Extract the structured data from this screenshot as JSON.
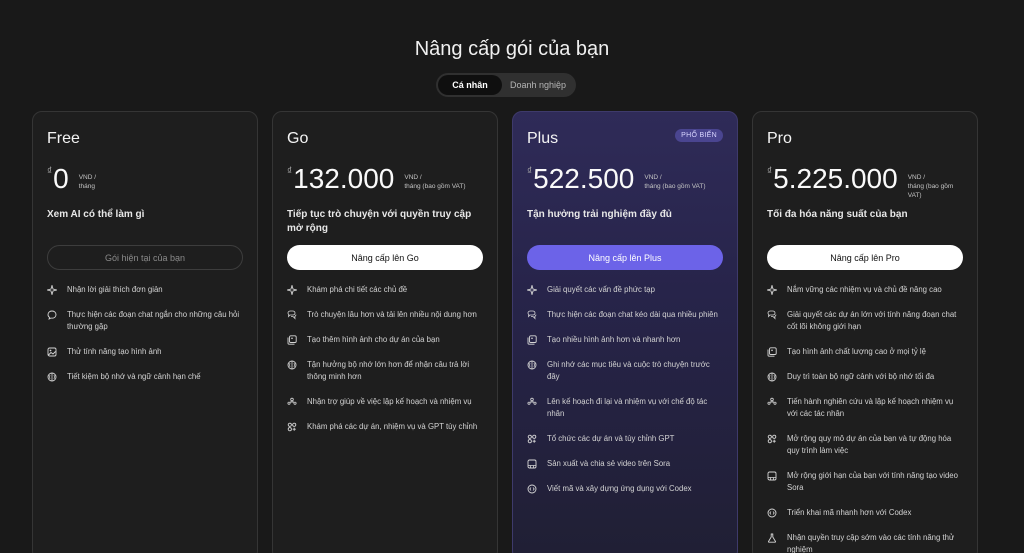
{
  "page_title": "Nâng cấp gói của bạn",
  "toggle": {
    "personal": "Cá nhân",
    "business": "Doanh nghiệp"
  },
  "plans": [
    {
      "name": "Free",
      "currency": "₫",
      "amount": "0",
      "price_line1": "VND /",
      "price_line2": "tháng",
      "tagline": "Xem AI có thể làm gì",
      "cta": "Gói hiện tại của bạn",
      "features": [
        {
          "icon": "sparkle-icon",
          "text": "Nhận lời giải thích đơn giản"
        },
        {
          "icon": "chat-bubble-icon",
          "text": "Thực hiện các đoạn chat ngắn cho những câu hỏi thường gặp"
        },
        {
          "icon": "image-icon",
          "text": "Thử tính năng tạo hình ảnh"
        },
        {
          "icon": "brain-icon",
          "text": "Tiết kiệm bộ nhớ và ngữ cảnh hạn chế"
        }
      ]
    },
    {
      "name": "Go",
      "currency": "₫",
      "amount": "132.000",
      "price_line1": "VND /",
      "price_line2": "tháng (bao gồm VAT)",
      "tagline": "Tiếp tục trò chuyện với quyền truy cập mở rộng",
      "cta": "Nâng cấp lên Go",
      "features": [
        {
          "icon": "sparkle-icon",
          "text": "Khám phá chi tiết các chủ đề"
        },
        {
          "icon": "chat-bubbles-icon",
          "text": "Trò chuyện lâu hơn và tải lên nhiều nội dung hơn"
        },
        {
          "icon": "images-icon",
          "text": "Tạo thêm hình ảnh cho dự án của bạn"
        },
        {
          "icon": "brain-icon",
          "text": "Tận hưởng bộ nhớ lớn hơn để nhận câu trả lời thông minh hơn"
        },
        {
          "icon": "team-icon",
          "text": "Nhận trợ giúp về việc lập kế hoạch và nhiệm vụ"
        },
        {
          "icon": "apps-icon",
          "text": "Khám phá các dự án, nhiệm vụ và GPT tùy chỉnh"
        }
      ]
    },
    {
      "name": "Plus",
      "badge": "PHỔ BIẾN",
      "currency": "₫",
      "amount": "522.500",
      "price_line1": "VND /",
      "price_line2": "tháng (bao gồm VAT)",
      "tagline": "Tận hưởng trải nghiệm đầy đủ",
      "cta": "Nâng cấp lên Plus",
      "features": [
        {
          "icon": "sparkle-icon",
          "text": "Giải quyết các vấn đề phức tạp"
        },
        {
          "icon": "chat-bubbles-icon",
          "text": "Thực hiện các đoạn chat kéo dài qua nhiều phiên"
        },
        {
          "icon": "images-icon",
          "text": "Tạo nhiều hình ảnh hơn và nhanh hơn"
        },
        {
          "icon": "brain-icon",
          "text": "Ghi nhớ các mục tiêu và cuộc trò chuyện trước đây"
        },
        {
          "icon": "team-icon",
          "text": "Lên kế hoạch đi lại và nhiệm vụ với chế độ tác nhân"
        },
        {
          "icon": "apps-icon",
          "text": "Tổ chức các dự án và tùy chỉnh GPT"
        },
        {
          "icon": "video-icon",
          "text": "Sản xuất và chia sẻ video trên Sora"
        },
        {
          "icon": "code-icon",
          "text": "Viết mã và xây dựng ứng dụng với Codex"
        }
      ]
    },
    {
      "name": "Pro",
      "currency": "₫",
      "amount": "5.225.000",
      "price_line1": "VND /",
      "price_line2": "tháng (bao gồm VAT)",
      "tagline": "Tối đa hóa năng suất của bạn",
      "cta": "Nâng cấp lên Pro",
      "features": [
        {
          "icon": "sparkle-icon",
          "text": "Nắm vững các nhiệm vụ và chủ đề nâng cao"
        },
        {
          "icon": "chat-bubbles-icon",
          "text": "Giải quyết các dự án lớn với tính năng đoạn chat cốt lõi không giới hạn"
        },
        {
          "icon": "images-icon",
          "text": "Tạo hình ảnh chất lượng cao ở mọi tỷ lệ"
        },
        {
          "icon": "brain-icon",
          "text": "Duy trì toàn bộ ngữ cảnh với bộ nhớ tối đa"
        },
        {
          "icon": "team-icon",
          "text": "Tiến hành nghiên cứu và lập kế hoạch nhiệm vụ với các tác nhân"
        },
        {
          "icon": "apps-icon",
          "text": "Mở rộng quy mô dự án của bạn và tự động hóa quy trình làm việc"
        },
        {
          "icon": "video-icon",
          "text": "Mở rộng giới hạn của bạn với tính năng tạo video Sora"
        },
        {
          "icon": "code-icon",
          "text": "Triển khai mã nhanh hơn với Codex"
        },
        {
          "icon": "flask-icon",
          "text": "Nhận quyền truy cập sớm vào các tính năng thử nghiệm"
        }
      ]
    }
  ],
  "colors": {
    "background": "#191919",
    "accent": "#6c63e8",
    "plus_card": "#2f2b58"
  }
}
